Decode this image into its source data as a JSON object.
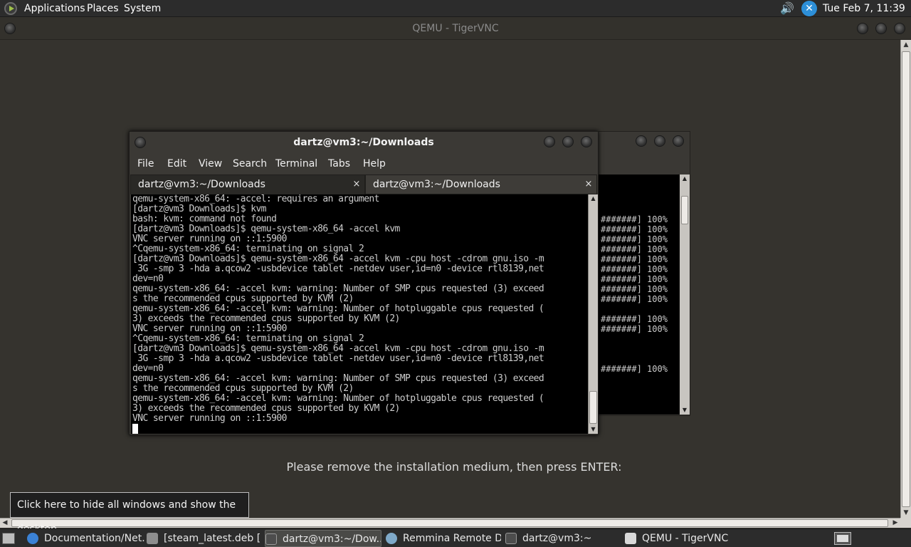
{
  "top_panel": {
    "menus": [
      "Applications",
      "Places",
      "System"
    ],
    "clock": "Tue Feb  7, 11:39 AM",
    "tray_icons": [
      "volume-icon",
      "network-icon"
    ]
  },
  "vnc_window": {
    "title": "QEMU - TigerVNC",
    "guest_message": "Please remove the installation medium, then press ENTER:"
  },
  "terminal": {
    "title": "dartz@vm3:~/Downloads",
    "menu": [
      "File",
      "Edit",
      "View",
      "Search",
      "Terminal",
      "Tabs",
      "Help"
    ],
    "tabs": [
      {
        "label": "dartz@vm3:~/Downloads",
        "close": "×"
      },
      {
        "label": "dartz@vm3:~/Downloads",
        "close": "×"
      }
    ],
    "lines": [
      "qemu-system-x86_64: -accel: requires an argument",
      "[dartz@vm3 Downloads]$ kvm",
      "bash: kvm: command not found",
      "[dartz@vm3 Downloads]$ qemu-system-x86_64 -accel kvm",
      "VNC server running on ::1:5900",
      "^Cqemu-system-x86_64: terminating on signal 2",
      "[dartz@vm3 Downloads]$ qemu-system-x86_64 -accel kvm -cpu host -cdrom gnu.iso -m",
      " 3G -smp 3 -hda a.qcow2 -usbdevice tablet -netdev user,id=n0 -device rtl8139,net",
      "dev=n0",
      "qemu-system-x86_64: -accel kvm: warning: Number of SMP cpus requested (3) exceed",
      "s the recommended cpus supported by KVM (2)",
      "qemu-system-x86_64: -accel kvm: warning: Number of hotpluggable cpus requested (",
      "3) exceeds the recommended cpus supported by KVM (2)",
      "VNC server running on ::1:5900",
      "^Cqemu-system-x86_64: terminating on signal 2",
      "[dartz@vm3 Downloads]$ qemu-system-x86_64 -accel kvm -cpu host -cdrom gnu.iso -m",
      " 3G -smp 3 -hda a.qcow2 -usbdevice tablet -netdev user,id=n0 -device rtl8139,net",
      "dev=n0",
      "qemu-system-x86_64: -accel kvm: warning: Number of SMP cpus requested (3) exceed",
      "s the recommended cpus supported by KVM (2)",
      "qemu-system-x86_64: -accel kvm: warning: Number of hotpluggable cpus requested (",
      "3) exceeds the recommended cpus supported by KVM (2)",
      "VNC server running on ::1:5900"
    ]
  },
  "back_terminal": {
    "lines": [
      "",
      "",
      "#######] 100%",
      "#######] 100%",
      "#######] 100%",
      "#######] 100%",
      "#######] 100%",
      "#######] 100%",
      "#######] 100%",
      "#######] 100%",
      "#######] 100%",
      "",
      "#######] 100%",
      "#######] 100%",
      "",
      "",
      "",
      "#######] 100%"
    ]
  },
  "tooltip": "Click here to hide all windows and show the desktop.",
  "taskbar": {
    "items": [
      {
        "label": "Documentation/Net...",
        "icon": "chrome-icon",
        "color": "#3b82d6"
      },
      {
        "label": "[steam_latest.deb [...",
        "icon": "package-manager-icon",
        "color": "#8e8e8e"
      },
      {
        "label": "dartz@vm3:~/Dow...",
        "icon": "terminal-icon",
        "color": "#4d4d4d"
      },
      {
        "label": "Remmina Remote D...",
        "icon": "remmina-icon",
        "color": "#7fa9c9"
      },
      {
        "label": "dartz@vm3:~",
        "icon": "terminal-icon",
        "color": "#4d4d4d"
      },
      {
        "label": "QEMU - TigerVNC",
        "icon": "tigervnc-icon",
        "color": "#d9d9d9"
      }
    ]
  }
}
